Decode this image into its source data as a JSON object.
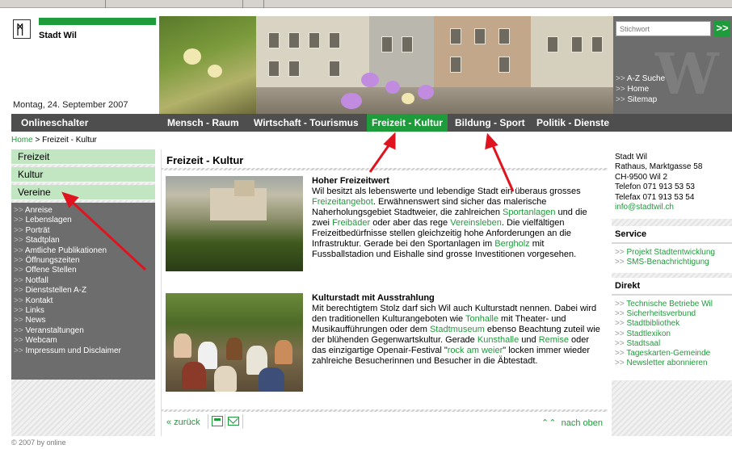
{
  "header": {
    "city_name": "Stadt Wil",
    "date": "Montag, 24. September 2007"
  },
  "search": {
    "placeholder": "Stichwort",
    "button": ">>"
  },
  "quick_links": [
    "A-Z Suche",
    "Home",
    "Sitemap"
  ],
  "nav": {
    "items": [
      "Onlineschalter",
      "Mensch - Raum",
      "Wirtschaft - Tourismus",
      "Freizeit - Kultur",
      "Bildung - Sport",
      "Politik - Dienste"
    ],
    "active": "Freizeit - Kultur"
  },
  "breadcrumb": {
    "home": "Home",
    "separator": " > ",
    "current": "Freizeit - Kultur"
  },
  "sidebar": {
    "sub_items": [
      "Freizeit",
      "Kultur",
      "Vereine"
    ],
    "links": [
      "Anreise",
      "Lebenslagen",
      "Porträt",
      "Stadtplan",
      "Amtliche Publikationen",
      "Öffnungszeiten",
      "Offene Stellen",
      "Notfall",
      "Dienststellen A-Z",
      "Kontakt",
      "Links",
      "News",
      "Veranstaltungen",
      "Webcam",
      "Impressum und Disclaimer"
    ]
  },
  "main": {
    "title": "Freizeit - Kultur",
    "article1": {
      "heading": "Hoher Freizeitwert",
      "p1": "Wil besitzt als lebenswerte und lebendige Stadt ein überaus grosses ",
      "l1": "Freizeitangebot",
      "p2": ". Erwähnenswert sind sicher das malerische Naherholungsgebiet Stadtweier, die zahlreichen ",
      "l2": "Sportanlagen",
      "p3": " und die zwei ",
      "l3": "Freibäder",
      "p4": " oder aber das rege ",
      "l4": "Vereinsleben",
      "p5": ". Die vielfältigen Freizeitbedürfnisse stellen gleichzeitig hohe Anforderungen an die Infrastruktur. Gerade bei den Sportanlagen im ",
      "l5": "Bergholz",
      "p6": " mit Fussballstadion und Eishalle sind grosse Investitionen vorgesehen."
    },
    "article2": {
      "heading": "Kulturstadt mit Ausstrahlung",
      "p1": "Mit berechtigtem Stolz darf sich Wil auch Kulturstadt nennen. Dabei wird den traditionellen Kulturangeboten wie ",
      "l1": "Tonhalle",
      "p2": " mit Theater- und Musikaufführungen oder dem ",
      "l2": "Stadtmuseum",
      "p3": " ebenso Beachtung zuteil wie der blühenden Gegenwartskultur. Gerade ",
      "l3": "Kunsthalle",
      "p4": " und ",
      "l4": "Remise",
      "p5": " oder das einzigartige Openair-Festival \"",
      "l5": "rock am weier",
      "p6": "\" locken immer wieder zahlreiche Besucherinnen und Besucher in die Äbtestadt."
    },
    "footer": {
      "back": "« zurück",
      "top": "nach oben"
    }
  },
  "address": {
    "lines": [
      "Stadt Wil",
      "Rathaus, Marktgasse 58",
      "CH-9500 Wil 2",
      "Telefon 071 913 53 53",
      "Telefax 071 913 53 54"
    ],
    "email": "info@stadtwil.ch"
  },
  "service": {
    "heading": "Service",
    "links": [
      "Projekt Stadtentwicklung",
      "SMS-Benachrichtigung"
    ]
  },
  "direkt": {
    "heading": "Direkt",
    "links": [
      "Technische Betriebe Wil",
      "Sicherheitsverbund",
      "Stadtbibliothek",
      "Stadtlexikon",
      "Stadtsaal",
      "Tageskarten-Gemeinde",
      "Newsletter abonnieren"
    ]
  },
  "copyright": "© 2007 by online",
  "colors": {
    "accent_green": "#1e9b3a",
    "nav_gray": "#4e4e4e",
    "annotation_red": "#e0141e"
  }
}
